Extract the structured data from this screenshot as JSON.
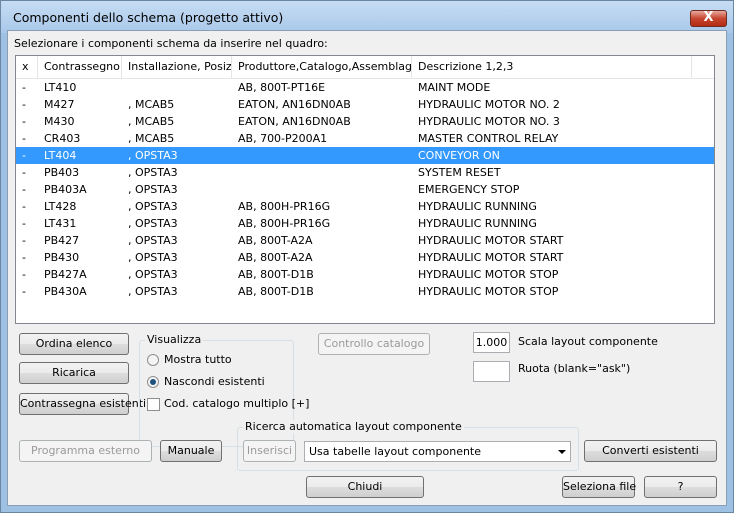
{
  "window": {
    "title": "Componenti dello schema (progetto attivo)",
    "close_label": "X"
  },
  "instruction": "Selezionare i componenti schema da inserire nel quadro:",
  "columns": [
    "x",
    "Contrassegno",
    "Installazione, Posiz...",
    "Produttore,Catalogo,Assemblaggio",
    "Descrizione 1,2,3"
  ],
  "rows": [
    {
      "x": "-",
      "tag": "LT410",
      "install": "",
      "catalog": "AB, 800T-PT16E",
      "desc": "MAINT MODE",
      "selected": false
    },
    {
      "x": "-",
      "tag": "M427",
      "install": ", MCAB5",
      "catalog": "EATON, AN16DN0AB",
      "desc": "HYDRAULIC MOTOR NO. 2",
      "selected": false
    },
    {
      "x": "-",
      "tag": "M430",
      "install": ", MCAB5",
      "catalog": "EATON, AN16DN0AB",
      "desc": "HYDRAULIC MOTOR NO. 3",
      "selected": false
    },
    {
      "x": "-",
      "tag": "CR403",
      "install": ", MCAB5",
      "catalog": "AB, 700-P200A1",
      "desc": "MASTER CONTROL RELAY",
      "selected": false
    },
    {
      "x": "-",
      "tag": "LT404",
      "install": ", OPSTA3",
      "catalog": "",
      "desc": "CONVEYOR ON",
      "selected": true
    },
    {
      "x": "-",
      "tag": "PB403",
      "install": ", OPSTA3",
      "catalog": "",
      "desc": "SYSTEM RESET",
      "selected": false
    },
    {
      "x": "-",
      "tag": "PB403A",
      "install": ", OPSTA3",
      "catalog": "",
      "desc": "EMERGENCY STOP",
      "selected": false
    },
    {
      "x": "-",
      "tag": "LT428",
      "install": ", OPSTA3",
      "catalog": "AB, 800H-PR16G",
      "desc": "HYDRAULIC RUNNING",
      "selected": false
    },
    {
      "x": "-",
      "tag": "LT431",
      "install": ", OPSTA3",
      "catalog": "AB, 800H-PR16G",
      "desc": "HYDRAULIC RUNNING",
      "selected": false
    },
    {
      "x": "-",
      "tag": "PB427",
      "install": ", OPSTA3",
      "catalog": "AB, 800T-A2A",
      "desc": "HYDRAULIC MOTOR START",
      "selected": false
    },
    {
      "x": "-",
      "tag": "PB430",
      "install": ", OPSTA3",
      "catalog": "AB, 800T-A2A",
      "desc": "HYDRAULIC MOTOR START",
      "selected": false
    },
    {
      "x": "-",
      "tag": "PB427A",
      "install": ", OPSTA3",
      "catalog": "AB, 800T-D1B",
      "desc": "HYDRAULIC MOTOR STOP",
      "selected": false
    },
    {
      "x": "-",
      "tag": "PB430A",
      "install": ", OPSTA3",
      "catalog": "AB, 800T-D1B",
      "desc": "HYDRAULIC MOTOR STOP",
      "selected": false
    }
  ],
  "buttons": {
    "sort": "Ordina elenco",
    "reload": "Ricarica",
    "mark_existing": "Contrassegna esistenti",
    "catalog_check": "Controllo catalogo",
    "external_program": "Programma esterno",
    "manual": "Manuale",
    "insert": "Inserisci",
    "convert_existing": "Converti esistenti",
    "close": "Chiudi",
    "select_file": "Seleziona file",
    "help": "?"
  },
  "display_group": {
    "title": "Visualizza",
    "show_all": "Mostra tutto",
    "hide_existing": "Nascondi esistenti",
    "selected_option": "hide_existing",
    "multi_catalog": "Cod. catalogo multiplo [+]",
    "multi_catalog_checked": false
  },
  "scale": {
    "value": "1.000",
    "label": "Scala layout componente"
  },
  "rotate": {
    "value": "",
    "label": "Ruota (blank=\"ask\")"
  },
  "auto_search": {
    "title": "Ricerca automatica layout componente",
    "selected": "Usa tabelle layout componente"
  },
  "colors": {
    "selection": "#3399ff",
    "title_bar": "#b9d1ea",
    "close_button": "#c6452f"
  }
}
